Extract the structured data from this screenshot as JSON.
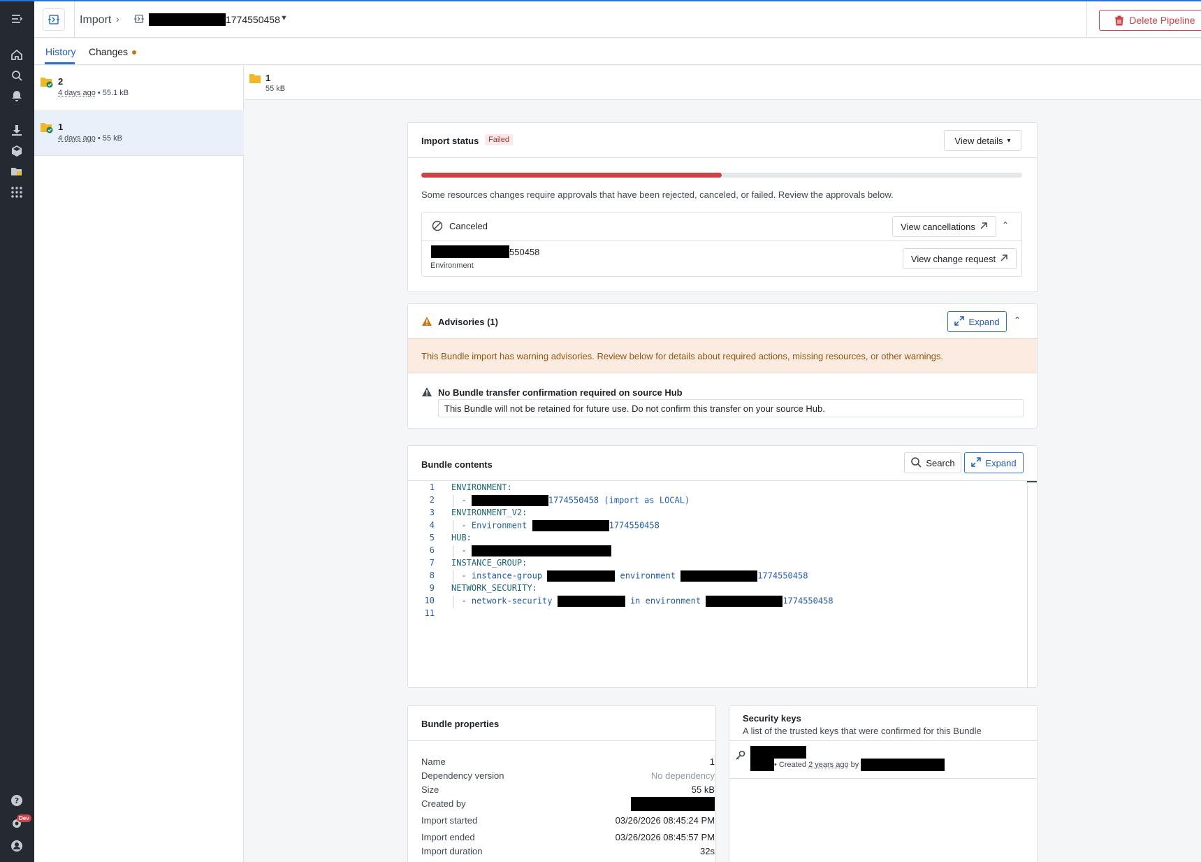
{
  "header": {
    "breadcrumb_root": "Import",
    "pipeline_name_suffix": "1774550458",
    "delete_label": "Delete Pipeline"
  },
  "tabs": {
    "history": "History",
    "changes": "Changes"
  },
  "history": [
    {
      "number": "2",
      "age": "4 days ago",
      "size": " • 55.1 kB"
    },
    {
      "number": "1",
      "age": "4 days ago",
      "size": " • 55 kB"
    }
  ],
  "main": {
    "number": "1",
    "size": "55 kB"
  },
  "import_status": {
    "title": "Import status",
    "status": "Failed",
    "view_details": "View details",
    "progress_fraction": 0.5,
    "message": "Some resources changes require approvals that have been rejected, canceled, or failed. Review the approvals below.",
    "canceled_label": "Canceled",
    "view_cancellations": "View cancellations",
    "item_suffix": "550458",
    "item_type": "Environment",
    "view_change_request": "View change request"
  },
  "advisories": {
    "title": "Advisories (1)",
    "expand": "Expand",
    "banner": "This Bundle import has warning advisories. Review below for details about required actions, missing resources, or other warnings.",
    "item_title": "No Bundle transfer confirmation required on source Hub",
    "item_desc": "This Bundle will not be retained for future use. Do not confirm this transfer on your source Hub."
  },
  "bundle_contents": {
    "title": "Bundle contents",
    "search": "Search",
    "expand": "Expand",
    "lines": [
      {
        "n": "1",
        "a": "ENVIRONMENT:"
      },
      {
        "n": "2",
        "a": "  - ",
        "b": "1774550458 (import as LOCAL)"
      },
      {
        "n": "3",
        "a": "ENVIRONMENT_V2:"
      },
      {
        "n": "4",
        "a": "  - Environment ",
        "b": "1774550458"
      },
      {
        "n": "5",
        "a": "HUB:"
      },
      {
        "n": "6",
        "a": "  - "
      },
      {
        "n": "7",
        "a": "INSTANCE_GROUP:"
      },
      {
        "n": "8",
        "a": "  - instance-group ",
        "m": " environment ",
        "b": "1774550458"
      },
      {
        "n": "9",
        "a": "NETWORK_SECURITY:"
      },
      {
        "n": "10",
        "a": "  - network-security ",
        "m": " in environment ",
        "b": "1774550458"
      },
      {
        "n": "11",
        "a": ""
      }
    ]
  },
  "bundle_properties": {
    "title": "Bundle properties",
    "rows": [
      {
        "label": "Name",
        "value": "1"
      },
      {
        "label": "Dependency version",
        "value": "No dependency"
      },
      {
        "label": "Size",
        "value": "55 kB"
      },
      {
        "label": "Created by",
        "value": ""
      },
      {
        "label": "Import started",
        "value": "03/26/2026 08:45:24 PM"
      },
      {
        "label": "Import ended",
        "value": "03/26/2026 08:45:57 PM"
      },
      {
        "label": "Import duration",
        "value": "32s"
      }
    ]
  },
  "security_keys": {
    "title": "Security keys",
    "subtitle": "A list of the trusted keys that were confirmed for this Bundle",
    "key_created_prefix": "• Created ",
    "key_created_age": "2 years ago",
    "key_created_by": " by "
  },
  "rail": {
    "dev_badge": "Dev"
  }
}
